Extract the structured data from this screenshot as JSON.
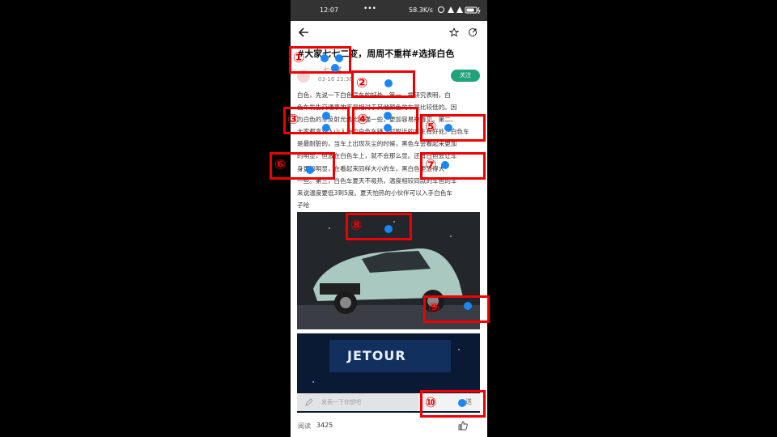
{
  "status_bar": {
    "time": "12:07",
    "speed": "58.3K/s",
    "dots": "•••"
  },
  "article": {
    "title": "#大家七七二变，周周不重样#选择白色",
    "author": "七七某",
    "date": "03-16 23:36",
    "follow_label": "关注",
    "paragraph_lines": [
      "白色，先说一下白色汽车的好处，第一、据研究表明，白",
      "色车发生交通事故率是相对于其他颜色的车是比较低的。因",
      "为白色的车反射光线比较强一些，更加容易被看见。第二、",
      "大家都喜欢人山人海中白色车辆，对附近的车主有好处。白色车",
      "是最耐脏的，当车上出现灰尘的时候，黑色车会看起来更加",
      "的明显，但放在白色车上，就不会那么显。还有白色会让车",
      "身更加明显，在看起来同样大小的车，黑白色更显得大",
      "一些。第三，白色车夏天不吸热，温度相较同款的车色的车",
      "来说温度要低3到5度。夏天怕热的小伙伴可以入手白色车",
      "子哈"
    ],
    "image2_text": "JETOUR"
  },
  "comment": {
    "placeholder": "发表一下你想吧",
    "send_label": "送"
  },
  "footer": {
    "reads_label": "阅读",
    "reads_count": "3425"
  },
  "annotations": [
    "①",
    "②",
    "③",
    "④",
    "⑤",
    "⑥",
    "⑦",
    "⑧",
    "⑨",
    "⑩"
  ]
}
